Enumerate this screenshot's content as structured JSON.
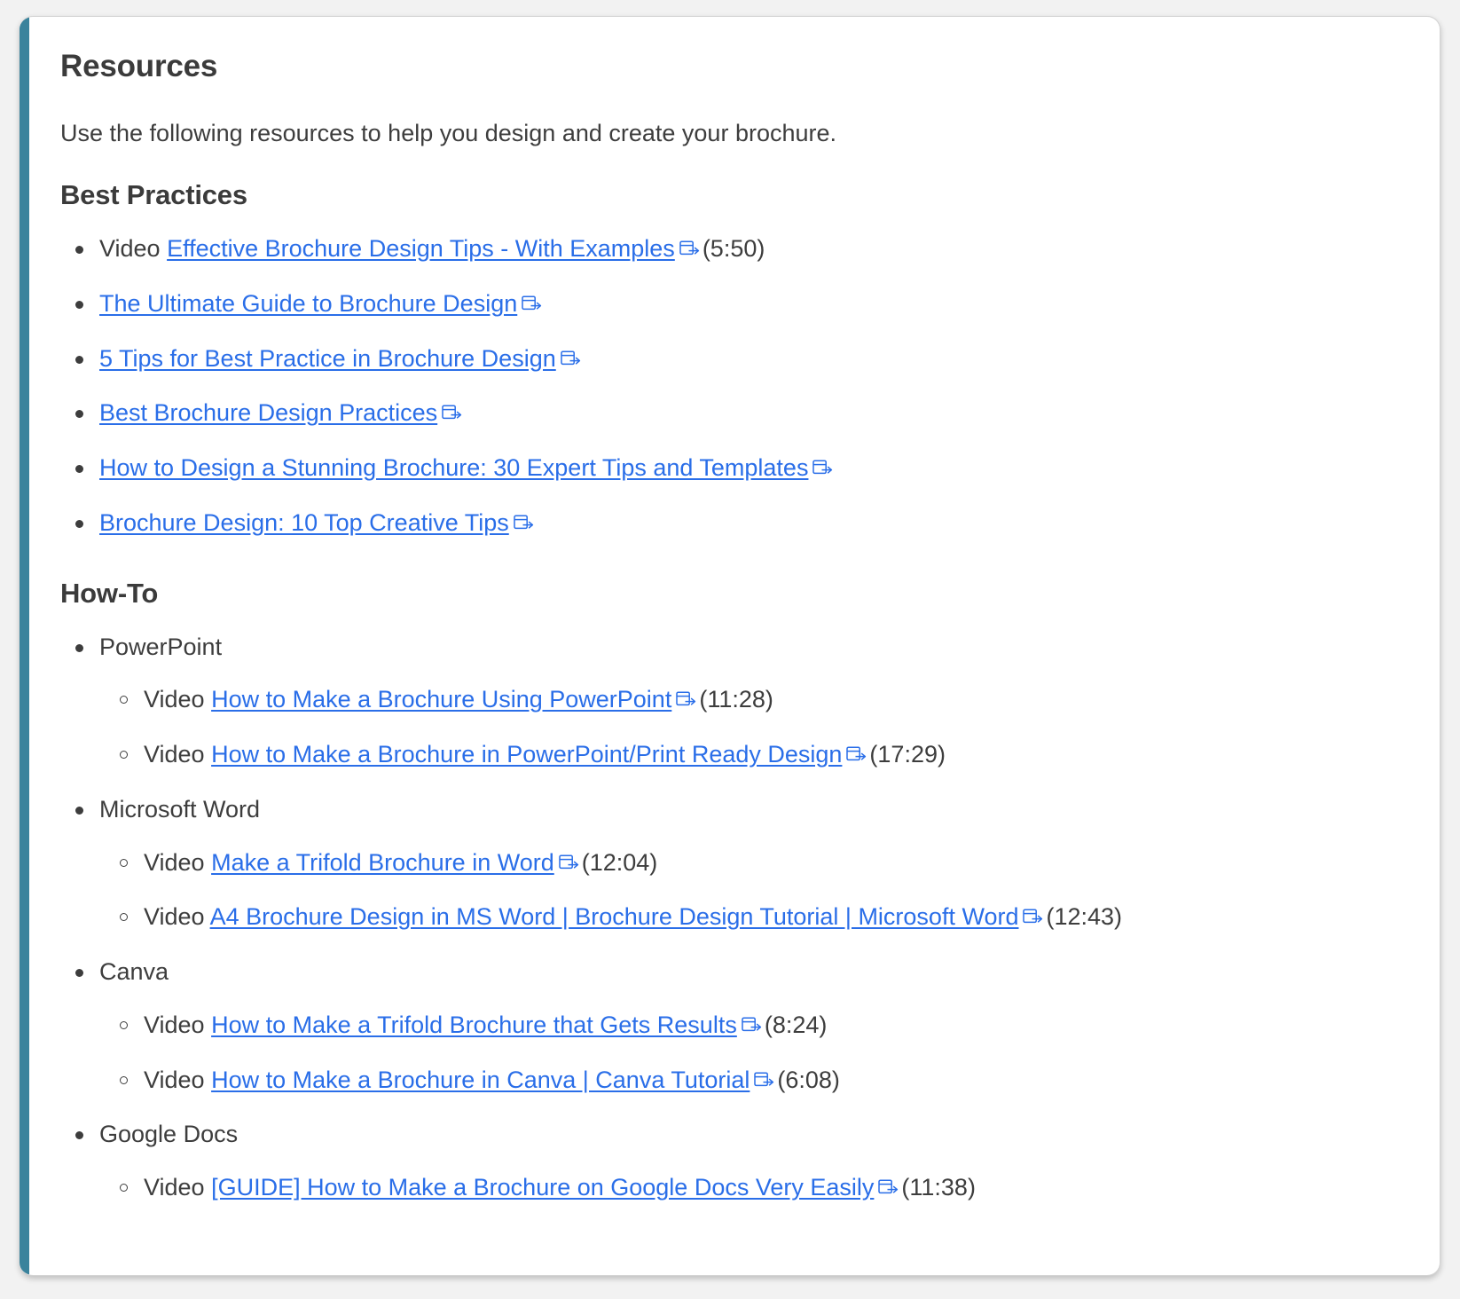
{
  "card": {
    "accent_color": "#3a839c",
    "link_color": "#2a6ee8",
    "text_color": "#3d3d3d",
    "heading_color": "#3b3b3b",
    "title": "Resources",
    "intro": "Use the following resources to help you design and create your brochure.",
    "external_link_icon": "external-link-icon"
  },
  "sections": [
    {
      "heading": "Best Practices",
      "items": [
        {
          "prefix": "Video ",
          "link": "Effective Brochure Design Tips - With Examples",
          "icon": "external-link-icon",
          "duration": "(5:50)"
        },
        {
          "prefix": "",
          "link": "The Ultimate Guide to Brochure Design",
          "icon": "external-link-icon",
          "duration": ""
        },
        {
          "prefix": "",
          "link": "5 Tips for Best Practice in Brochure Design",
          "icon": "external-link-icon",
          "duration": ""
        },
        {
          "prefix": "",
          "link": "Best Brochure Design Practices",
          "icon": "external-link-icon",
          "duration": ""
        },
        {
          "prefix": "",
          "link": "How to Design a Stunning Brochure: 30 Expert Tips and Templates",
          "icon": "external-link-icon",
          "duration": ""
        },
        {
          "prefix": "",
          "link": "Brochure Design: 10 Top Creative Tips",
          "icon": "external-link-icon",
          "duration": ""
        }
      ]
    },
    {
      "heading": "How-To",
      "groups": [
        {
          "label": "PowerPoint",
          "items": [
            {
              "prefix": "Video ",
              "link": "How to Make a Brochure Using PowerPoint",
              "icon": "external-link-icon",
              "duration": "(11:28)"
            },
            {
              "prefix": "Video ",
              "link": "How to Make a Brochure in PowerPoint/Print Ready Design",
              "icon": "external-link-icon",
              "duration": "(17:29)"
            }
          ]
        },
        {
          "label": "Microsoft Word",
          "items": [
            {
              "prefix": "Video ",
              "link": "Make a Trifold Brochure in Word",
              "icon": "external-link-icon",
              "duration": "(12:04)"
            },
            {
              "prefix": "Video ",
              "link": "A4 Brochure Design in MS Word | Brochure Design Tutorial | Microsoft Word",
              "icon": "external-link-icon",
              "duration": "(12:43)"
            }
          ]
        },
        {
          "label": "Canva",
          "items": [
            {
              "prefix": "Video ",
              "link": "How to Make a Trifold Brochure that Gets Results",
              "icon": "external-link-icon",
              "duration": "(8:24)"
            },
            {
              "prefix": "Video ",
              "link": "How to Make a Brochure in Canva | Canva Tutorial",
              "icon": "external-link-icon",
              "duration": "(6:08)"
            }
          ]
        },
        {
          "label": "Google Docs",
          "items": [
            {
              "prefix": "Video ",
              "link": "[GUIDE] How to Make a Brochure on Google Docs Very Easily",
              "icon": "external-link-icon",
              "duration": "(11:38)"
            }
          ]
        }
      ]
    }
  ]
}
